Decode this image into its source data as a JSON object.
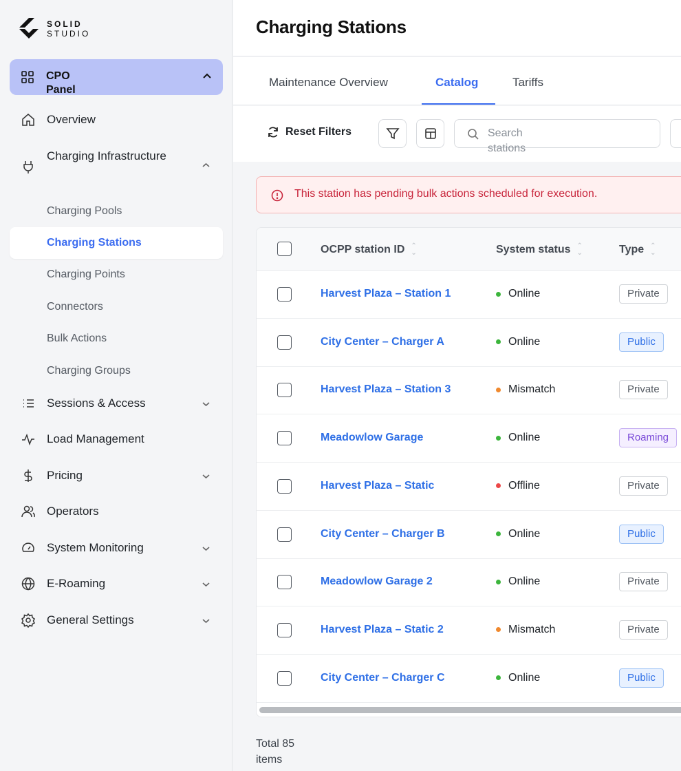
{
  "brand": {
    "line1": "SOLID",
    "line2": "STUDIO"
  },
  "sidebar": {
    "panel": {
      "label": "CPO Panel",
      "icon": "grid-icon"
    },
    "items": [
      {
        "label": "Overview",
        "icon": "home-icon"
      },
      {
        "label": "Charging Infrastructure",
        "icon": "plug-icon",
        "expanded": true
      },
      {
        "label": "Sessions & Access",
        "icon": "list-icon"
      },
      {
        "label": "Load Management",
        "icon": "pulse-icon"
      },
      {
        "label": "Pricing",
        "icon": "dollar-icon"
      },
      {
        "label": "Operators",
        "icon": "users-icon"
      },
      {
        "label": "System Monitoring",
        "icon": "gauge-icon"
      },
      {
        "label": "E-Roaming",
        "icon": "globe-icon"
      },
      {
        "label": "General Settings",
        "icon": "gear-icon"
      }
    ],
    "subitems": [
      {
        "label": "Charging Pools"
      },
      {
        "label": "Charging Stations",
        "active": true
      },
      {
        "label": "Charging Points"
      },
      {
        "label": "Connectors"
      },
      {
        "label": "Bulk Actions"
      },
      {
        "label": "Charging Groups"
      }
    ]
  },
  "page": {
    "title": "Charging Stations"
  },
  "tabs": [
    {
      "label": "Maintenance Overview"
    },
    {
      "label": "Catalog",
      "active": true
    },
    {
      "label": "Tariffs"
    }
  ],
  "toolbar": {
    "reset_label": "Reset Filters",
    "search_placeholder": "Search stations"
  },
  "alert": {
    "text": "This station has pending bulk actions scheduled for execution."
  },
  "table": {
    "columns": [
      "OCPP station ID",
      "System status",
      "Type"
    ],
    "rows": [
      {
        "id": "Harvest Plaza – Station 1",
        "status": "Online",
        "type": "Private"
      },
      {
        "id": "City Center – Charger A",
        "status": "Online",
        "type": "Public"
      },
      {
        "id": "Harvest Plaza – Station 3",
        "status": "Mismatch",
        "type": "Private"
      },
      {
        "id": "Meadowlow Garage",
        "status": "Online",
        "type": "Roaming"
      },
      {
        "id": "Harvest Plaza – Static",
        "status": "Offline",
        "type": "Private"
      },
      {
        "id": "City Center – Charger B",
        "status": "Online",
        "type": "Public"
      },
      {
        "id": "Meadowlow Garage 2",
        "status": "Online",
        "type": "Private"
      },
      {
        "id": "Harvest Plaza – Static 2",
        "status": "Mismatch",
        "type": "Private"
      },
      {
        "id": "City Center – Charger C",
        "status": "Online",
        "type": "Public"
      }
    ]
  },
  "footer": {
    "total": "Total 85 items"
  },
  "colors": {
    "accent": "#3b6cf0",
    "status_online": "#3cb53c",
    "status_mismatch": "#f0892e",
    "status_offline": "#ec4848",
    "badge_private_border": "#cfd2d6",
    "badge_public_bg": "#e8f1ff",
    "badge_roaming_bg": "#f5efff"
  }
}
